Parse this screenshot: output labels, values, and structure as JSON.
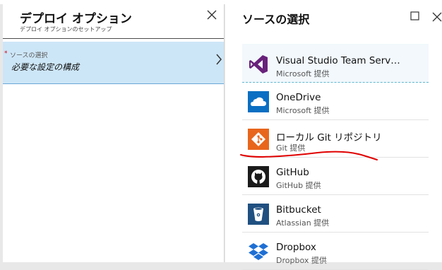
{
  "left_blade": {
    "title": "デプロイ オプション",
    "subtitle": "デプロイ オプションのセットアップ",
    "selected_item": {
      "required_marker": "*",
      "label": "ソースの選択",
      "value": "必要な設定の構成"
    }
  },
  "right_blade": {
    "title": "ソースの選択",
    "sources": [
      {
        "name": "Visual Studio Team Serv…",
        "provider": "Microsoft 提供",
        "icon": "visual-studio-icon",
        "color": "#68217a"
      },
      {
        "name": "OneDrive",
        "provider": "Microsoft 提供",
        "icon": "onedrive-icon",
        "color": "#0a6fc2"
      },
      {
        "name": "ローカル Git リポジトリ",
        "provider": "Git 提供",
        "icon": "git-icon",
        "color": "#e8661c"
      },
      {
        "name": "GitHub",
        "provider": "GitHub 提供",
        "icon": "github-icon",
        "color": "#1b1b1b"
      },
      {
        "name": "Bitbucket",
        "provider": "Atlassian 提供",
        "icon": "bitbucket-icon",
        "color": "#205081"
      },
      {
        "name": "Dropbox",
        "provider": "Dropbox 提供",
        "icon": "dropbox-icon",
        "color": "#1e6fd4"
      }
    ]
  },
  "colors": {
    "selected_bg": "#cde6f7",
    "annotation": "#e00000"
  }
}
